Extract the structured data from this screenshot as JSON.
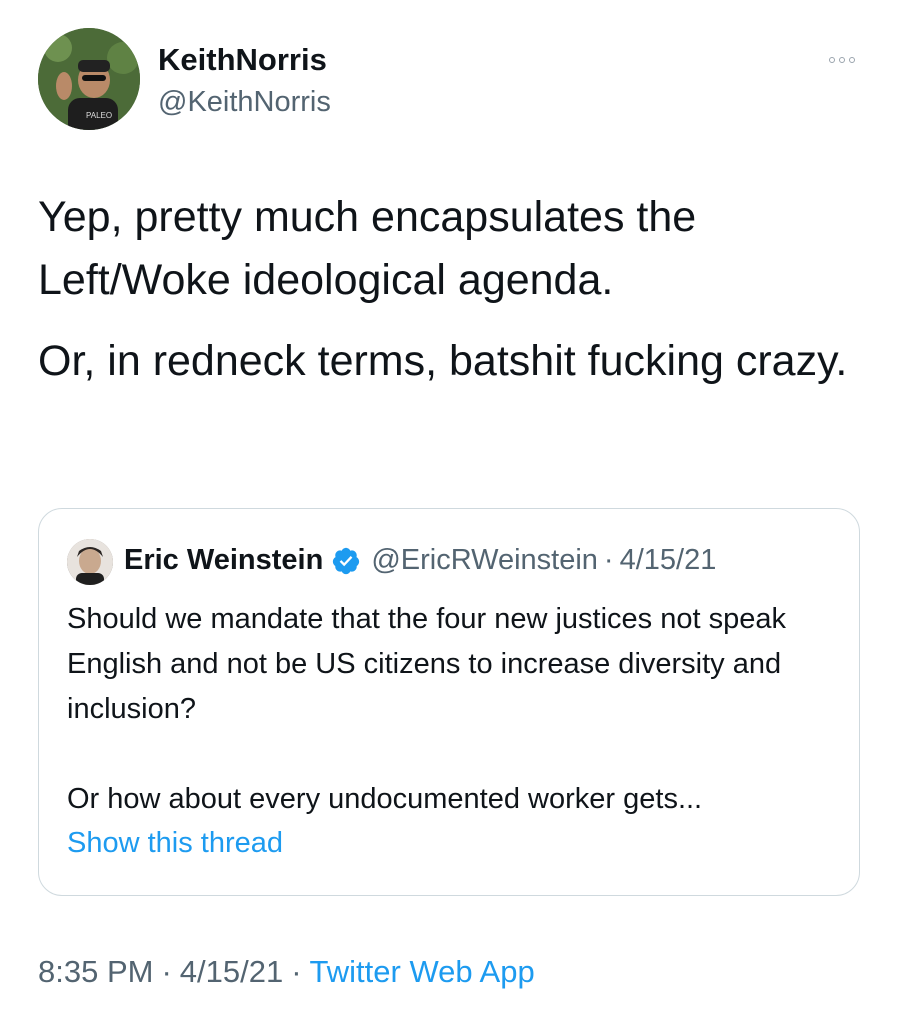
{
  "author": {
    "name": "KeithNorris",
    "handle": "@KeithNorris"
  },
  "tweet": {
    "paragraphs": [
      "Yep, pretty much encapsulates the Left/Woke ideological agenda.",
      "Or, in redneck terms, batshit fucking crazy."
    ]
  },
  "quoted": {
    "name": "Eric Weinstein",
    "verified": true,
    "handle": "@EricRWeinstein",
    "separator": "·",
    "date": "4/15/21",
    "paragraphs": [
      "Should we mandate that the four new justices not speak English and not be US citizens to increase diversity and inclusion?",
      "Or how about every undocumented worker gets..."
    ],
    "show_thread": "Show this thread"
  },
  "meta": {
    "time": "8:35 PM",
    "date": "4/15/21",
    "separator": "·",
    "source": "Twitter Web App"
  },
  "colors": {
    "text": "#0f1419",
    "secondary": "#536471",
    "accent": "#1d9bf0",
    "border": "#cfd9de"
  },
  "icons": {
    "more": "more-horizontal-icon",
    "verified": "verified-badge-icon"
  }
}
